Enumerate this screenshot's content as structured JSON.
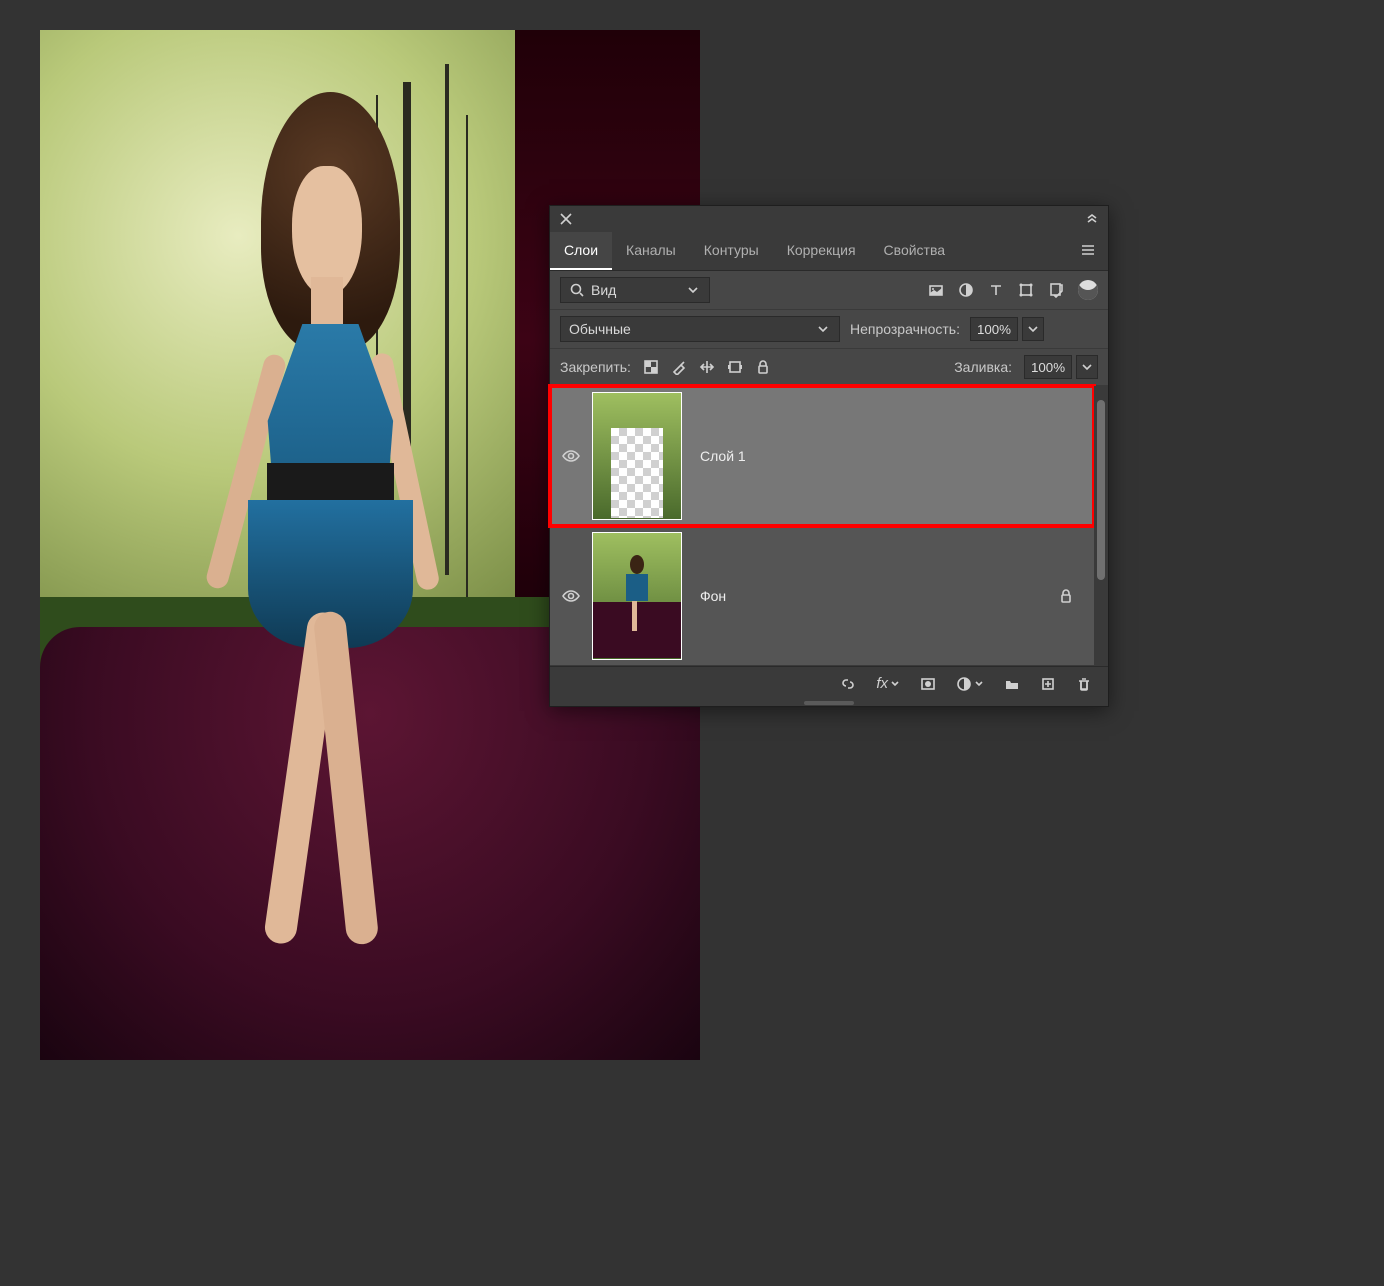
{
  "panel": {
    "tabs": [
      "Слои",
      "Каналы",
      "Контуры",
      "Коррекция",
      "Свойства"
    ],
    "active_tab": 0,
    "filter_label": "Вид",
    "blend_mode": "Обычные",
    "opacity_label": "Непрозрачность:",
    "opacity_value": "100%",
    "lock_label": "Закрепить:",
    "fill_label": "Заливка:",
    "fill_value": "100%"
  },
  "layers": [
    {
      "name": "Слой 1",
      "visible": true,
      "locked": false,
      "highlighted": true,
      "thumb": "cutout"
    },
    {
      "name": "Фон",
      "visible": true,
      "locked": true,
      "highlighted": false,
      "thumb": "full"
    }
  ]
}
